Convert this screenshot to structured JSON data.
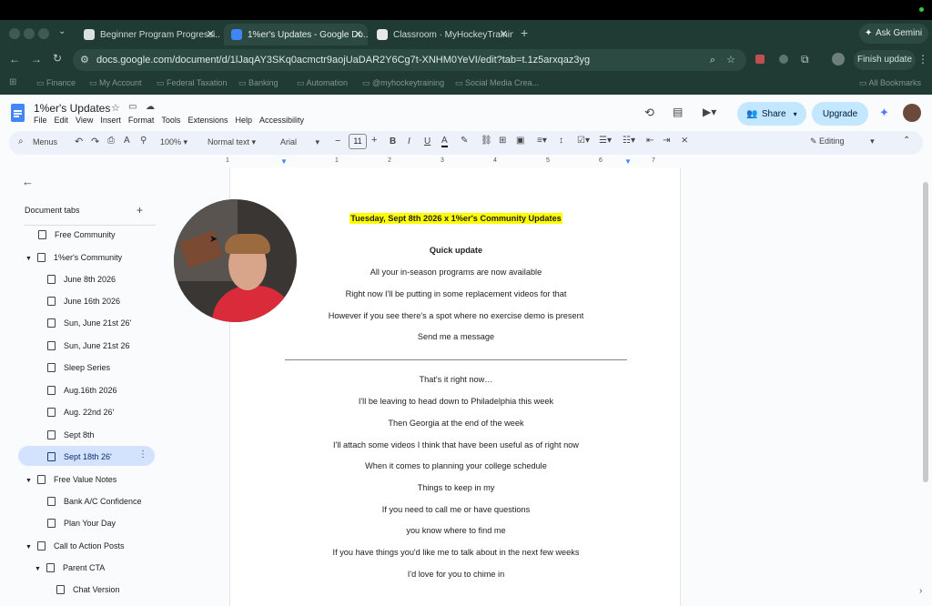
{
  "browser": {
    "tabs": [
      {
        "label": "Beginner Program Progressi..."
      },
      {
        "label": "1%er's Updates - Google Do..."
      },
      {
        "label": "Classroom · MyHockeyTrainin..."
      }
    ],
    "ask_gemini": "Ask Gemini",
    "url": "docs.google.com/document/d/1lJaqAY3SKq0acmctr9aojUaDAR2Y6Cg7t-XNHM0YeVI/edit?tab=t.1z5arxqaz3yg",
    "finish_update": "Finish update",
    "bookmarks": [
      "Finance",
      "My Account",
      "Federal Taxation",
      "Banking",
      "Automation",
      "@myhockeytraining",
      "Social Media Crea..."
    ],
    "all_bookmarks": "All Bookmarks"
  },
  "doc": {
    "title": "1%er's Updates",
    "menu": [
      "File",
      "Edit",
      "View",
      "Insert",
      "Format",
      "Tools",
      "Extensions",
      "Help",
      "Accessibility"
    ],
    "share": "Share",
    "upgrade": "Upgrade",
    "toolbar": {
      "menus": "Menus",
      "zoom": "100%",
      "style": "Normal text",
      "font": "Arial",
      "size": "11",
      "mode": "Editing"
    },
    "ruler": [
      "1",
      "1",
      "2",
      "3",
      "4",
      "5",
      "6",
      "7"
    ]
  },
  "sidebar": {
    "heading": "Document tabs",
    "items": [
      {
        "label": "Free Community"
      },
      {
        "label": "1%er's Community"
      },
      {
        "label": "June 8th 2026"
      },
      {
        "label": "June 16th 2026"
      },
      {
        "label": "Sun, June 21st 26'"
      },
      {
        "label": "Sun, June 21st 26"
      },
      {
        "label": "Sleep Series"
      },
      {
        "label": "Aug.16th 2026"
      },
      {
        "label": "Aug. 22nd 26'"
      },
      {
        "label": "Sept 8th"
      },
      {
        "label": "Sept 18th 26'"
      },
      {
        "label": "Free Value Notes"
      },
      {
        "label": "Bank A/C Confidence"
      },
      {
        "label": "Plan Your Day"
      },
      {
        "label": "Call to Action Posts"
      },
      {
        "label": "Parent CTA"
      },
      {
        "label": "Chat Version"
      }
    ]
  },
  "content": {
    "heading": "Tuesday, Sept 8th 2026 x 1%er's Community Updates",
    "subheading": "Quick update",
    "lines": [
      "All your in-season programs are now available",
      "Right now I'll be putting in some replacement videos for that",
      "However if you see there's a spot where no exercise demo is present",
      "Send me a message",
      "That's it right now…",
      "I'll be leaving to head down to Philadelphia this week",
      "Then Georgia at the end of the week",
      "I'll attach some videos I think that have been useful as of right now",
      "When it comes to planning your college schedule",
      "Things to keep in my",
      "If you need to call me or have questions",
      "you know where to find me",
      "If you have things you'd like me to talk about in the next few weeks",
      "I'd love for you to chime in"
    ]
  },
  "colors": {
    "chrome": "#1f3b33",
    "highlight": "#ffff00",
    "share_bg": "#c2e7ff",
    "selected_tab": "#d3e3fd"
  }
}
